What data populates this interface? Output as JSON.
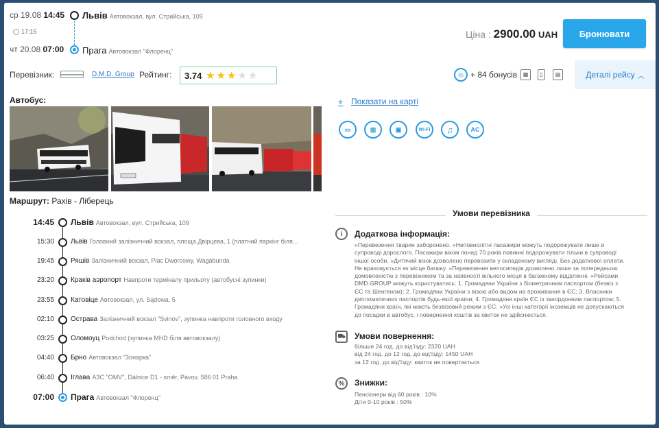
{
  "header": {
    "departure": {
      "date": "ср 19.08",
      "time": "14:45",
      "city": "Львів",
      "station": "Автовокзал, вул. Стрийська, 109"
    },
    "duration": "17:15",
    "arrival": {
      "date": "чт 20.08",
      "time": "07:00",
      "city": "Прага",
      "station": "Автовокзал \"Флоренц\""
    },
    "price_label": "Ціна :",
    "price_value": "2900.00",
    "currency": "UAH",
    "book_button": "Бронювати"
  },
  "carrier": {
    "label": "Перевізник:",
    "name": "D.M.D. Group",
    "rating_label": "Рейтинг:",
    "rating_value": "3.74",
    "stars_filled": 3,
    "stars_total": 5
  },
  "bonus_text": "+ 84 бонусів",
  "details_button": "Деталі рейсу",
  "bus_label": "Автобус:",
  "route": {
    "label": "Маршрут:",
    "value": "Рахів - Ліберець"
  },
  "map_link": "Показати на карті",
  "amenities": [
    "tv-icon",
    "usb-icon",
    "usb-charge-icon",
    "wifi-icon",
    "music-icon",
    "ac-icon"
  ],
  "amenity_labels": [
    "",
    "",
    "",
    "Wi-Fi",
    "",
    "AC"
  ],
  "stops": [
    {
      "time": "14:45",
      "name": "Львів",
      "address": "Автовокзал, вул. Стрийська, 109",
      "major": true
    },
    {
      "time": "15:30",
      "name": "Львів",
      "address": "Головний залізничний вокзал, площа Двірцева, 1 (платний паркінг біля...",
      "major": false
    },
    {
      "time": "19:45",
      "name": "Ряшів",
      "address": "Залізничний вокзал, Plac Dworcowy, Wagabunda",
      "major": false
    },
    {
      "time": "23:20",
      "name": "Краків аэропорт",
      "address": "Навпроти терміналу прильоту (автобусні зупинки)",
      "major": false
    },
    {
      "time": "23:55",
      "name": "Катовіце",
      "address": "Автовокзал, ул. Sądowa, 5",
      "major": false
    },
    {
      "time": "02:10",
      "name": "Острава",
      "address": "Залізничний вокзал \"Svinov\", зупинка навпроти головного входу",
      "major": false
    },
    {
      "time": "03:25",
      "name": "Оломоуц",
      "address": "Podchod (зупинка MHD біля автовокзалу)",
      "major": false
    },
    {
      "time": "04:40",
      "name": "Брно",
      "address": "Автовокзал \"Зонаркa\"",
      "major": false
    },
    {
      "time": "06:40",
      "name": "Їглава",
      "address": "АЗС \"OMV\", Dálnice D1 - směr, Pávov, 586 01 Praha",
      "major": false
    },
    {
      "time": "07:00",
      "name": "Прага",
      "address": "Автовокзал \"Флоренц\"",
      "major": true
    }
  ],
  "conditions": {
    "title": "Умови перевізника",
    "info_title": "Додаткова інформація:",
    "info_lines": [
      "»Перевезення тварин заборонено. »Неповнолітні пасажири можуть подорожувати лише в",
      "супроводі дорослого. Пасажири віком понад 70 років повинні подорожувати тільки в супроводі",
      "іншої особи. »Дитячий візок дозволено перевозити у складеному вигляді. Без додаткової оплати.",
      "Не враховується як місце багажу. »Перевезення велосипедів дозволено лише за попередньою",
      "домовленістю з перевізником та за наявності вільного місця в багажному відділенні. »Рейсами",
      "DMD GROUP можуть користуватись: 1. Громадяни України з біометричним паспортом (безвіз з",
      "ЄС та Шенгеном); 2. Громадяни України з візою або видом на проживання в ЄС; 3. Власники",
      "дипломатичних паспортів будь-якої країни; 4. Громадяни країн ЄС із закордонним паспортом; 5.",
      "Громадяни країн, які мають безвізовий режим з ЄС. »Усі інші категорії іноземців не допускаються",
      "до посадки в автобус, і повернення коштів за квиток не здійснюється."
    ],
    "refund_title": "Умови повернення:",
    "refund_lines": [
      "більше 24 год. до від'їзду: 2320 UAH",
      "від 24 год. до 12 год. до від'їзду: 1450 UAH",
      "за 12 год. до від'їзду: квиток не повертається"
    ],
    "discount_title": "Знижки:",
    "discount_lines": [
      "Пенсіонери від 60 років : 10%",
      "Діти 0-10 років : 50%"
    ]
  }
}
